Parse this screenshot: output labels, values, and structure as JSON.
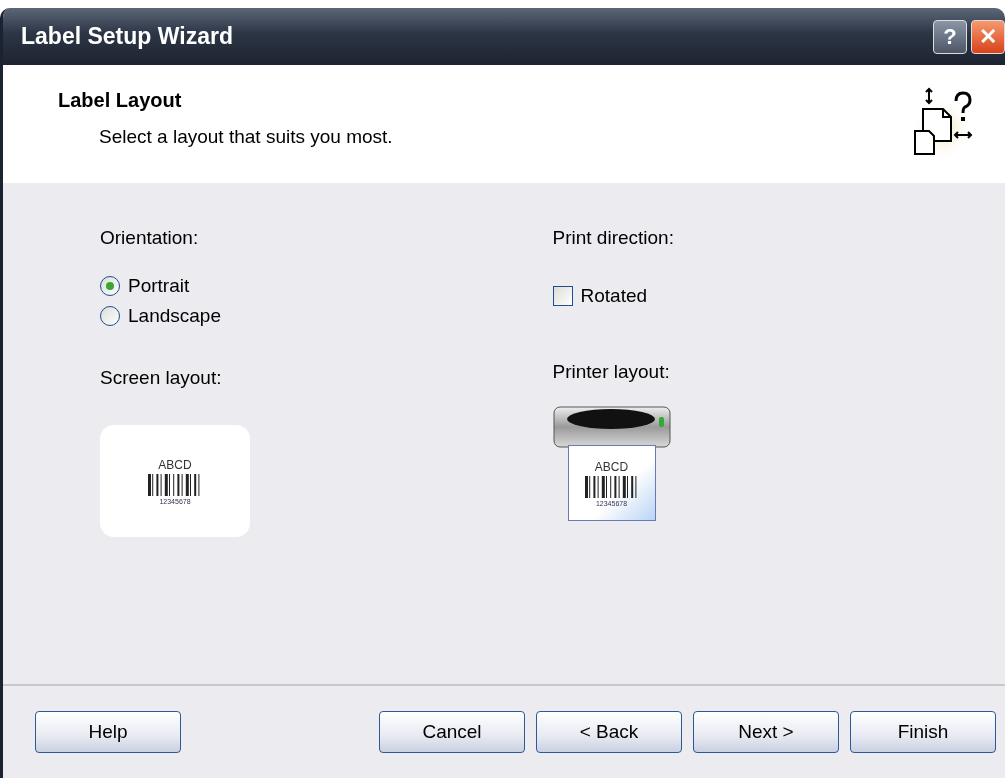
{
  "window": {
    "title": "Label Setup Wizard",
    "help_button": "?",
    "close_button": "✕"
  },
  "header": {
    "title": "Label Layout",
    "subtitle": "Select a layout that suits you most."
  },
  "orientation": {
    "label": "Orientation:",
    "options": [
      {
        "label": "Portrait",
        "selected": true
      },
      {
        "label": "Landscape",
        "selected": false
      }
    ]
  },
  "print_direction": {
    "label": "Print direction:",
    "options": [
      {
        "label": "Rotated",
        "checked": false
      }
    ]
  },
  "screen_layout": {
    "label": "Screen layout:",
    "preview_title": "ABCD",
    "preview_number": "12345678"
  },
  "printer_layout": {
    "label": "Printer layout:",
    "preview_title": "ABCD",
    "preview_number": "12345678"
  },
  "buttons": [
    {
      "label": "Help",
      "kind": "help"
    },
    {
      "label": "Cancel",
      "kind": "nav"
    },
    {
      "label": "< Back",
      "kind": "nav"
    },
    {
      "label": "Next >",
      "kind": "nav"
    },
    {
      "label": "Finish",
      "kind": "nav"
    }
  ]
}
